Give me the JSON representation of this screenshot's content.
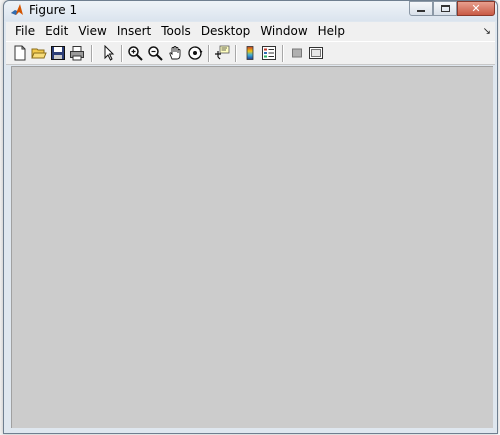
{
  "window": {
    "title": "Figure 1",
    "app_icon": "matlab-logo-icon",
    "controls": {
      "minimize_icon": "minimize-icon",
      "maximize_icon": "maximize-icon",
      "close_icon": "close-icon"
    }
  },
  "menubar": {
    "items": [
      "File",
      "Edit",
      "View",
      "Insert",
      "Tools",
      "Desktop",
      "Window",
      "Help"
    ],
    "dock_arrow_icon": "dock-arrow-icon"
  },
  "toolbar": {
    "buttons": [
      "new-figure-icon",
      "open-file-icon",
      "save-figure-icon",
      "print-figure-icon",
      "edit-plot-icon",
      "zoom-in-icon",
      "zoom-out-icon",
      "pan-icon",
      "rotate-3d-icon",
      "data-cursor-icon",
      "insert-colorbar-icon",
      "insert-legend-icon",
      "hide-plot-tools-icon",
      "show-plot-tools-icon"
    ]
  },
  "canvas": {
    "background": "#cccccc"
  }
}
